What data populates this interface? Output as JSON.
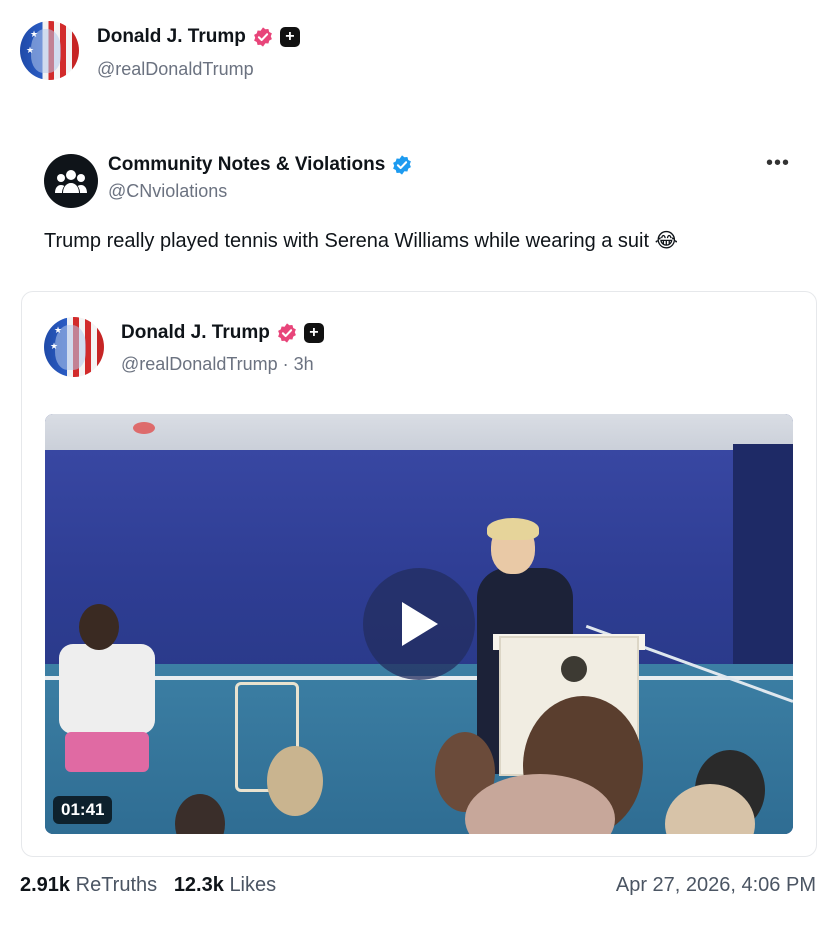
{
  "author": {
    "name": "Donald J. Trump",
    "handle": "@realDonaldTrump",
    "verified_color": "#e8457a"
  },
  "quoted_post": {
    "account_name": "Community Notes & Violations",
    "account_handle": "@CNviolations",
    "verified_color": "#1d9bf0",
    "more_icon": "more-dots-icon",
    "text": "Trump really played tennis with Serena Williams while wearing a suit",
    "emoji": "😂"
  },
  "embedded_post": {
    "name": "Donald J. Trump",
    "handle": "@realDonaldTrump",
    "separator": " · ",
    "time": "3h",
    "video": {
      "duration": "01:41",
      "play_icon": "play-icon"
    }
  },
  "stats": {
    "retruths_count": "2.91k",
    "retruths_label": "ReTruths",
    "likes_count": "12.3k",
    "likes_label": "Likes",
    "timestamp": "Apr 27, 2026, 4:06 PM"
  }
}
